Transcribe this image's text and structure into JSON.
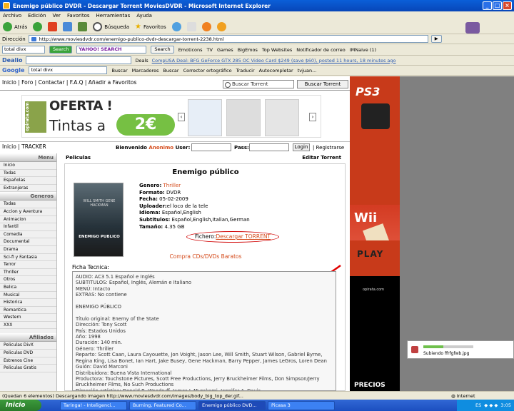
{
  "window": {
    "title": "Enemigo público DVDR - Descargar Torrent MoviesDVDR - Microsoft Internet Explorer"
  },
  "menu": [
    "Archivo",
    "Edición",
    "Ver",
    "Favoritos",
    "Herramientas",
    "Ayuda"
  ],
  "toolbar": {
    "back": "Atrás",
    "search": "Búsqueda",
    "favorites": "Favoritos"
  },
  "address": {
    "label": "Dirección",
    "url": "http://www.moviesdvdr.com/enemigo-publico-dvdr-descargar-torrent-2238.html"
  },
  "toolbar2": {
    "query": "total divx",
    "search_btn": "Search",
    "yahoo": "YAHOO! SEARCH",
    "search2": "Search",
    "emoticons": "Emoticons",
    "tv": "TV",
    "games": "Games",
    "bigemos": "BigEmos",
    "top": "Top Websites",
    "notif": "Notificador de correo",
    "imnaive": "IMNaive (1)"
  },
  "toolbar3": {
    "dealio": "Dealio",
    "deals": "Deals",
    "ticker": "CompUSA Deal: BFG GeForce GTX 285 OC Video Card $249 (save $60), posted 11 hours, 18 minutes ago"
  },
  "toolbar4": {
    "google": "Google",
    "query": "total divx",
    "buscar": "Buscar",
    "marcadores": "Marcadores",
    "buscar2": "Buscar",
    "corrector": "Corrector ortográfico",
    "traducir": "Traducir",
    "autocompletar": "Autocompletar",
    "user": "tvjuan..."
  },
  "topnav": {
    "links": "Inicio | Foro | Contactar | F.A.Q | Añadir a Favoritos",
    "search_placeholder": "Buscar Torrent",
    "search_btn": "Buscar Torrent"
  },
  "banner": {
    "logo": "opirata.com",
    "oferta": "OFERTA !",
    "tintas": "Tintas a",
    "price": "2€"
  },
  "login": {
    "tracker": "Inicio | TRACKER",
    "welcome": "Bienvenido",
    "anon": "Anonimo",
    "user": "User:",
    "pass": "Pass:",
    "login_btn": "Login",
    "register": "| Registrarse"
  },
  "sidebar": {
    "menu_head": "Menu",
    "menu_items": [
      "Inicio",
      "Todas",
      "Españolas",
      "Extranjeras"
    ],
    "genres_head": "Generos",
    "genres": [
      "Todas",
      "Accion y Aventura",
      "Animacion",
      "Infantil",
      "Comedia",
      "Documental",
      "Drama",
      "Sci-fi y Fantasia",
      "Terror",
      "Thriller",
      "Otros",
      "Belica",
      "Musical",
      "Historica",
      "Romantica",
      "Western",
      "XXX"
    ],
    "afiliados_head": "Afiliados",
    "afiliados": [
      "Peliculas DivX",
      "Peliculas DVD",
      "Estrenos Cine",
      "Peliculas Gratis"
    ]
  },
  "tabs": {
    "left": "Peliculas",
    "right": "Editar Torrent"
  },
  "movie": {
    "title": "Enemigo público",
    "poster_actors": "WILL SMITH  GENE HACKMAN",
    "poster_title": "ENEMIGO PUBLICO",
    "genero_l": "Genero:",
    "genero": "Thriller",
    "formato_l": "Formato:",
    "formato": "DVDR",
    "fecha_l": "Fecha:",
    "fecha": "05-02-2009",
    "uploader_l": "Uploader:",
    "uploader": "el loco de la tele",
    "idioma_l": "Idioma:",
    "idioma": "Español,English",
    "subtitulos_l": "Subtitulos:",
    "subtitulos": "Español,English,Italian,German",
    "tamano_l": "Tamaño:",
    "tamano": "4.35 GB",
    "fichero_l": "Fichero:",
    "fichero": "Descargar TORRENT",
    "compra": "Compra CDs/DVDs Baratos",
    "ficha_l": "Ficha Tecnica:",
    "ficha": "AUDIO: AC3 5.1 Español e Inglés\nSUBTITULOS: Español, Inglés, Alemán e Italiano\nMENÚ: Intacto\nEXTRAS: No contiene\n\nENEMIGO PÚBLICO\n\nTítulo original: Enemy of the State\nDirección: Tony Scott\nPaís: Estados Unidos\nAño: 1998\nDuración: 140 min.\nGénero: Thriller\nReparto: Scott Caan, Laura Cayouette, Jon Voight, Jason Lee, Will Smith, Stuart Wilson, Gabriel Byrne, Regina King, Lisa Bonet, Ian Hart, Jake Busey, Gene Hackman, Barry Pepper, James LeGros, Loren Dean\nGuión: David Marconi\nDistribuidora: Buena Vista International\nProductora: Touchstone Pictures, Scott Free Productions, Jerry Bruckheimer Films, Don Simpson/Jerry Bruckheimer Films, No Such Productions\nDirección artística: Donald B. Woodruff, James J. Murakami, Jennifer A. Davis"
  },
  "ads": {
    "ps3": "PS3",
    "wii": "Wii",
    "play": "PLAY",
    "opirata": "opirata.com",
    "precios": "PRECIOS"
  },
  "upload": {
    "label": "Subiendo ffrfgfwb.jpg",
    "progress": 0.4
  },
  "status": {
    "text": "(Quedan 6 elementos) Descargando imagen http://www.moviesdvdr.com/images/body_big_top_der.gif...",
    "zone": "Internet"
  },
  "taskbar": {
    "start": "Inicio",
    "tasks": [
      "Taringa! - Inteligenci...",
      "Burning, Featured Co...",
      "Enemigo público DVD...",
      "Picasa 3"
    ],
    "lang": "ES",
    "time": "3:05"
  }
}
